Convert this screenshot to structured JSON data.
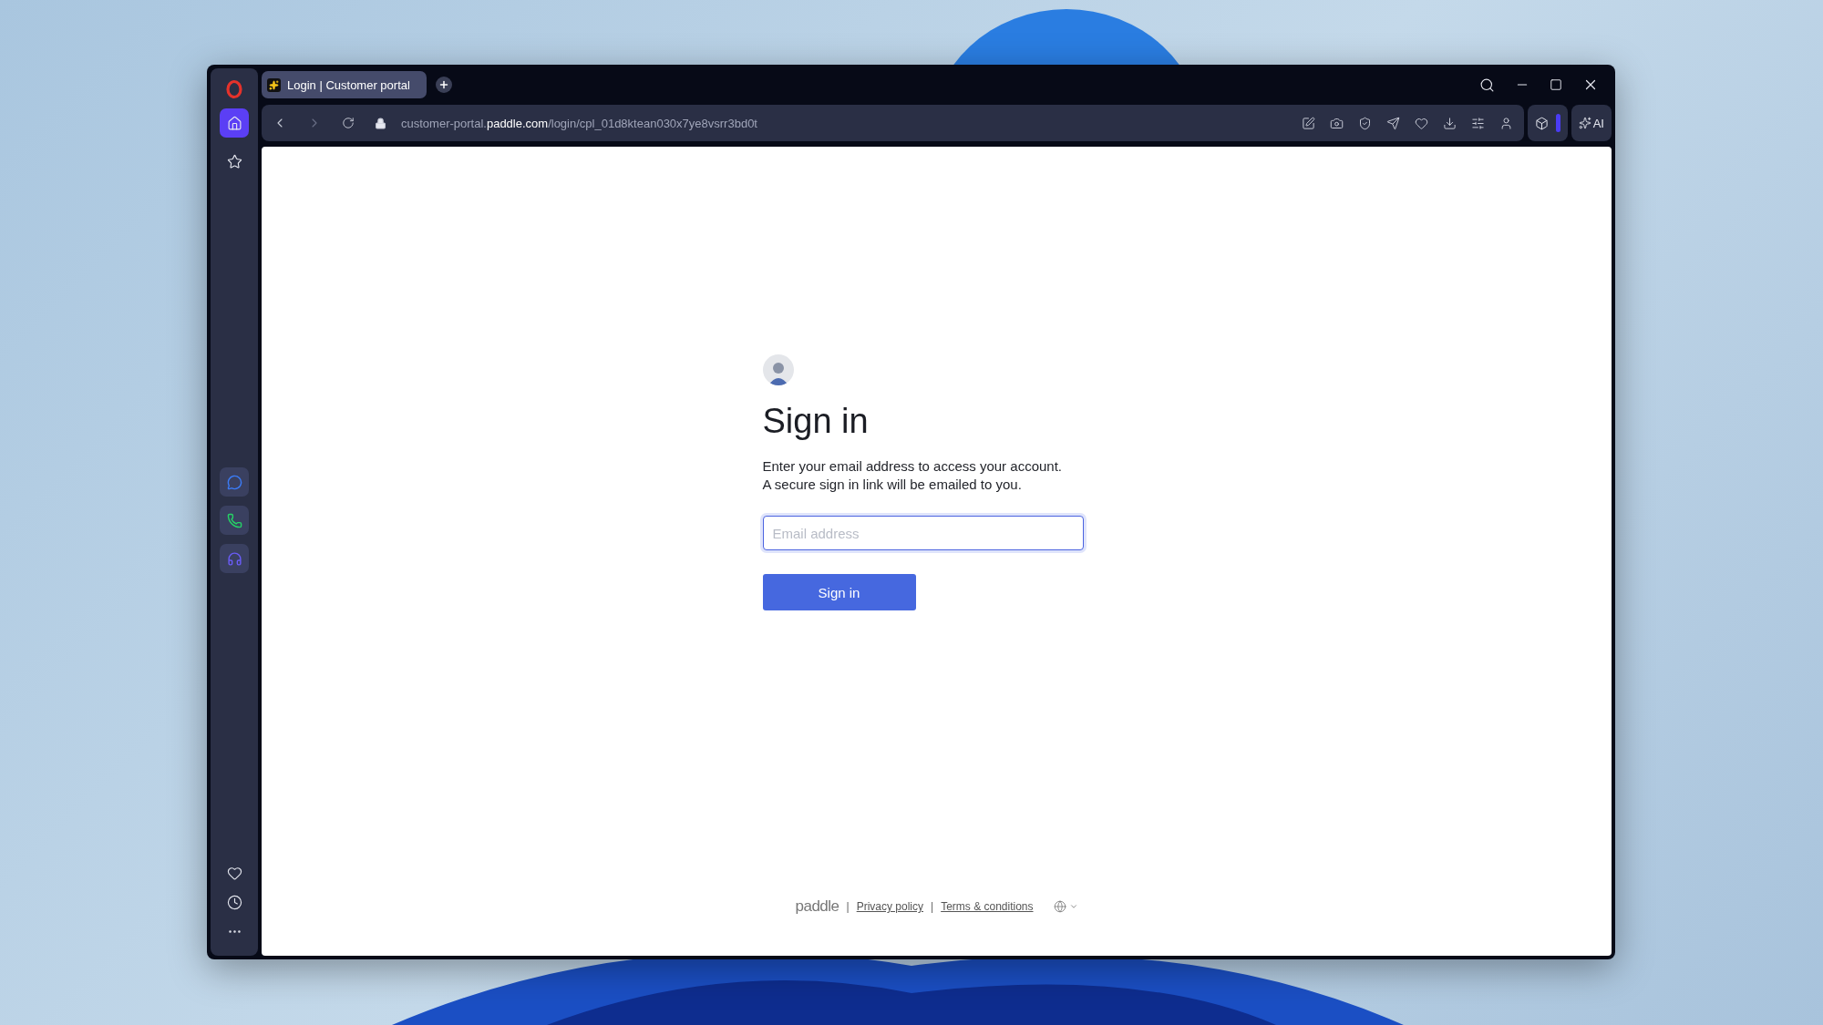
{
  "browser": {
    "tabs": [
      {
        "title": "Login | Customer portal",
        "selected": true
      }
    ],
    "sidebar": {
      "items": [
        {
          "kind": "home",
          "selected": true
        },
        {
          "kind": "star",
          "selected": false
        }
      ],
      "apps": [
        {
          "kind": "messenger"
        },
        {
          "kind": "whatsapp"
        },
        {
          "kind": "music"
        }
      ],
      "bottom": [
        {
          "kind": "heart"
        },
        {
          "kind": "history"
        },
        {
          "kind": "more"
        }
      ]
    },
    "address": {
      "subdomain": "customer-portal.",
      "domain": "paddle.com",
      "path": "/login/cpl_01d8ktean030x7ye8vsrr3bd0t"
    },
    "ai_button": "AI"
  },
  "page": {
    "title": "Sign in",
    "description": [
      "Enter your email address to access your account.",
      "A secure sign in link will be emailed to you."
    ],
    "email": {
      "placeholder": "Email address",
      "focused": true
    },
    "submit": "Sign in",
    "footer": {
      "brand": "paddle",
      "separator": "|",
      "links": [
        "Privacy policy",
        "Terms & conditions"
      ]
    }
  }
}
